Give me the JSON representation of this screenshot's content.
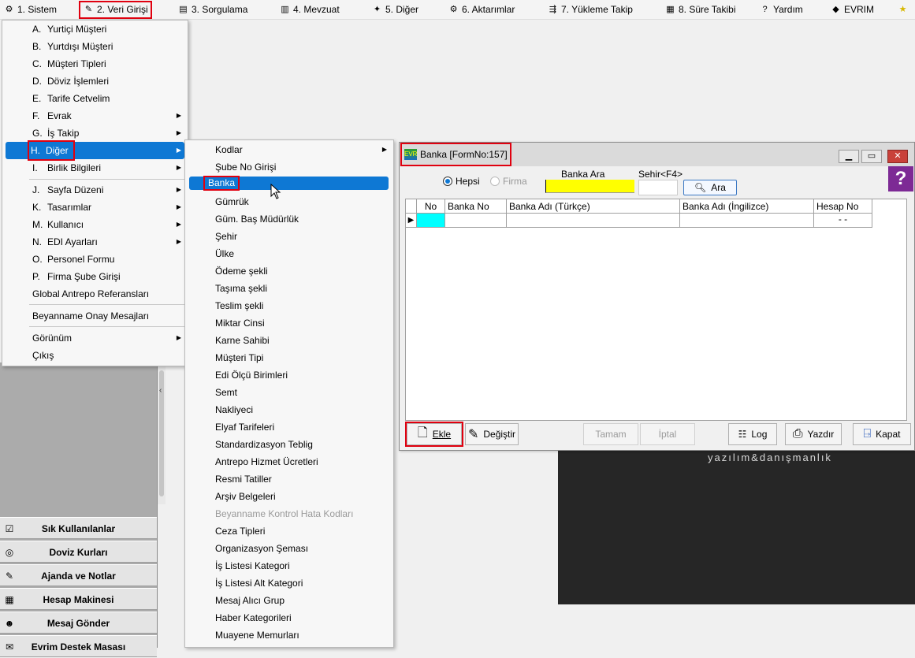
{
  "menubar": [
    {
      "icon": "gear-icon",
      "glyph": "⚙",
      "label": "1.  Sistem"
    },
    {
      "icon": "edit-icon",
      "glyph": "✎",
      "label": "2.  Veri Girişi"
    },
    {
      "icon": "query-icon",
      "glyph": "▤",
      "label": "3.  Sorgulama"
    },
    {
      "icon": "library-icon",
      "glyph": "▥",
      "label": "4.  Mevzuat"
    },
    {
      "icon": "shapes-icon",
      "glyph": "✦",
      "label": "5.  Diğer"
    },
    {
      "icon": "transfer-icon",
      "glyph": "⚙",
      "label": "6.  Aktarımlar"
    },
    {
      "icon": "truck-icon",
      "glyph": "⇶",
      "label": "7.  Yükleme Takip"
    },
    {
      "icon": "calendar-icon",
      "glyph": "▦",
      "label": "8. Süre Takibi"
    },
    {
      "icon": "help-icon",
      "glyph": "?",
      "label": "Yardım"
    },
    {
      "icon": "evrim-icon",
      "glyph": "◆",
      "label": "EVRIM"
    },
    {
      "icon": "star-icon",
      "glyph": "★",
      "label": ""
    }
  ],
  "main_menu": {
    "items": [
      {
        "key": "A.",
        "label": "Yurtiçi Müşteri",
        "sub": false
      },
      {
        "key": "B.",
        "label": "Yurtdışı Müşteri",
        "sub": false
      },
      {
        "key": "C.",
        "label": "Müşteri Tipleri",
        "sub": false
      },
      {
        "key": "D.",
        "label": "Döviz İşlemleri",
        "sub": false
      },
      {
        "key": "E.",
        "label": "Tarife Cetvelim",
        "sub": false
      },
      {
        "key": "F.",
        "label": "Evrak",
        "sub": true
      },
      {
        "key": "G.",
        "label": "İş Takip",
        "sub": true
      },
      {
        "key": "H.",
        "label": "Diğer",
        "sub": true
      },
      {
        "key": "I.",
        "label": "Birlik Bilgileri",
        "sub": true
      },
      {
        "key": "J.",
        "label": "Sayfa Düzeni",
        "sub": true
      },
      {
        "key": "K.",
        "label": "Tasarımlar",
        "sub": true
      },
      {
        "key": "M.",
        "label": "Kullanıcı",
        "sub": true
      },
      {
        "key": "N.",
        "label": "EDI Ayarları",
        "sub": true
      },
      {
        "key": "O.",
        "label": "Personel Formu",
        "sub": false
      },
      {
        "key": "P.",
        "label": "Firma Şube Girişi",
        "sub": false
      },
      {
        "key": "",
        "label": "Global Antrepo Referansları",
        "sub": false
      },
      {
        "key": "",
        "label": "Beyanname Onay Mesajları",
        "sub": false
      },
      {
        "key": "",
        "label": "Görünüm",
        "sub": true
      },
      {
        "key": "",
        "label": "Çıkış",
        "sub": false
      }
    ]
  },
  "sub_menu": {
    "items": [
      "Kodlar",
      "Şube No Girişi",
      "Banka",
      "Gümrük",
      "Güm. Baş Müdürlük",
      "Şehir",
      "Ülke",
      "Ödeme şekli",
      "Taşıma şekli",
      "Teslim şekli",
      "Miktar Cinsi",
      "Karne Sahibi",
      "Müşteri  Tipi",
      "Edi Ölçü Birimleri",
      "Semt",
      "Nakliyeci",
      "Elyaf Tarifeleri",
      "Standardizasyon Teblig",
      "Antrepo Hizmet Ücretleri",
      "Resmi Tatiller",
      "Arşiv Belgeleri",
      "Beyanname Kontrol Hata Kodları",
      "Ceza Tipleri",
      "Organizasyon Şeması",
      "İş Listesi Kategori",
      "İş Listesi Alt Kategori",
      "Mesaj Alıcı Grup",
      "Haber Kategorileri",
      "Muayene Memurları"
    ]
  },
  "quick_panel": [
    {
      "icon": "calendar-check-icon",
      "glyph": "☑",
      "label": "Sık Kullanılanlar"
    },
    {
      "icon": "currency-icon",
      "glyph": "◎",
      "label": "Doviz Kurları"
    },
    {
      "icon": "notes-icon",
      "glyph": "✎",
      "label": "Ajanda ve Notlar"
    },
    {
      "icon": "calculator-icon",
      "glyph": "▦",
      "label": "Hesap Makinesi"
    },
    {
      "icon": "users-icon",
      "glyph": "☻",
      "label": "Mesaj Gönder"
    },
    {
      "icon": "support-icon",
      "glyph": "✉",
      "label": "Evrim Destek Masası"
    }
  ],
  "branding": {
    "tagline": "yazılım&danışmanlık"
  },
  "window": {
    "title": "Banka [FormNo:157]",
    "filter": {
      "radio_all": "Hepsi",
      "radio_firm": "Firma",
      "search_label": "Banka Ara",
      "search_value": "",
      "city_label": "Sehir<F4>",
      "city_value": "",
      "search_button": "Ara"
    },
    "grid": {
      "columns": [
        "No",
        "Banka No",
        "Banka Adı (Türkçe)",
        "Banka Adı (İngilizce)",
        "Hesap No"
      ],
      "rows": [
        [
          "",
          "",
          "",
          "",
          "-  -"
        ]
      ]
    },
    "actions": {
      "add": "Ekle",
      "edit": "Değiştir",
      "ok": "Tamam",
      "cancel": "İptal",
      "log": "Log",
      "print": "Yazdır",
      "close": "Kapat"
    }
  },
  "colors": {
    "highlight": "#0e78d4",
    "selection_outline": "#e0000f",
    "search_field": "#ffff00",
    "active_cell": "#00ffff"
  }
}
